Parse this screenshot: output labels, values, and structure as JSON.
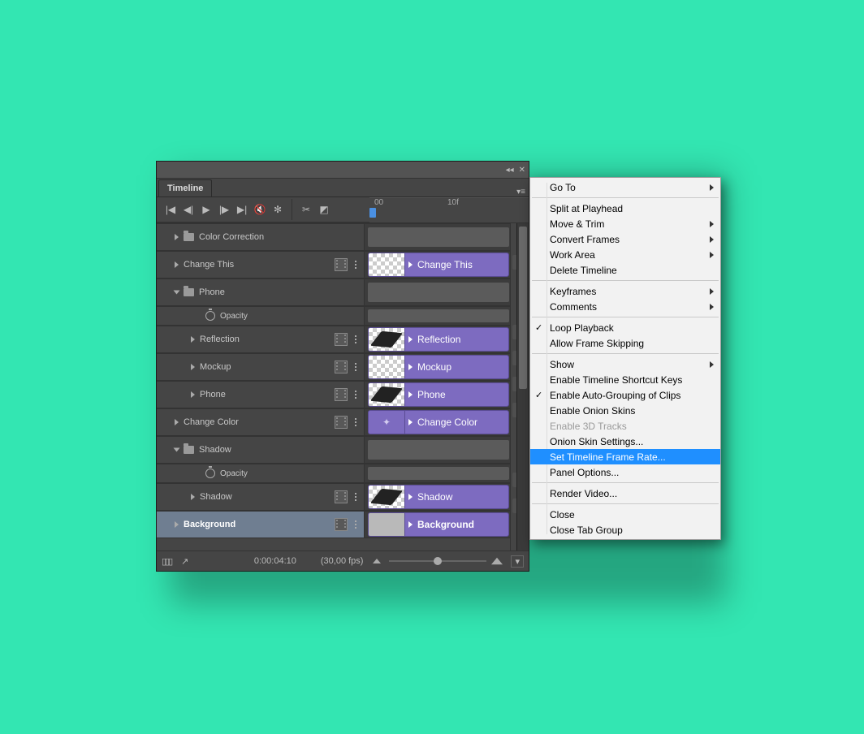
{
  "panel": {
    "title": "Timeline"
  },
  "ruler": {
    "t0": "00",
    "t1": "10f"
  },
  "layers": [
    {
      "id": "cc",
      "label": "Color Correction",
      "indent": 1,
      "folder": true,
      "open": false,
      "film": false,
      "kind": "folder"
    },
    {
      "id": "ct",
      "label": "Change This",
      "indent": 1,
      "open": false,
      "film": true,
      "kind": "layer",
      "clip": "Change This",
      "plus": true,
      "thumb": "checker"
    },
    {
      "id": "ph",
      "label": "Phone",
      "indent": 1,
      "folder": true,
      "open": true,
      "film": false,
      "kind": "folder",
      "bar": true
    },
    {
      "id": "ph_op",
      "label": "Opacity",
      "indent": 3,
      "stopwatch": true,
      "kind": "prop",
      "sub": true
    },
    {
      "id": "refl",
      "label": "Reflection",
      "indent": 2,
      "open": false,
      "film": true,
      "kind": "layer",
      "clip": "Reflection",
      "plus": true,
      "thumb": "device"
    },
    {
      "id": "mock",
      "label": "Mockup",
      "indent": 2,
      "open": false,
      "film": true,
      "kind": "layer",
      "clip": "Mockup",
      "plus": true,
      "thumb": "checker"
    },
    {
      "id": "phone2",
      "label": "Phone",
      "indent": 2,
      "open": false,
      "film": true,
      "kind": "layer",
      "clip": "Phone",
      "plus": true,
      "thumb": "device"
    },
    {
      "id": "cc2",
      "label": "Change Color",
      "indent": 1,
      "open": false,
      "film": true,
      "kind": "layer",
      "clip": "Change Color",
      "plus": true,
      "thumb": "icon"
    },
    {
      "id": "shg",
      "label": "Shadow",
      "indent": 1,
      "folder": true,
      "open": true,
      "film": false,
      "kind": "folder",
      "bar": true
    },
    {
      "id": "sh_op",
      "label": "Opacity",
      "indent": 3,
      "stopwatch": true,
      "kind": "prop",
      "sub": true
    },
    {
      "id": "sh",
      "label": "Shadow",
      "indent": 2,
      "open": false,
      "film": true,
      "kind": "layer",
      "clip": "Shadow",
      "plus": true,
      "thumb": "device"
    },
    {
      "id": "bg",
      "label": "Background",
      "indent": 1,
      "open": false,
      "film": true,
      "kind": "layer",
      "selected": true,
      "clip": "Background",
      "plus": true,
      "thumb": "gray",
      "bold": true
    }
  ],
  "footer": {
    "time": "0:00:04:10",
    "fps": "(30,00 fps)"
  },
  "menu": [
    {
      "label": "Go To",
      "sub": true
    },
    {
      "sep": true
    },
    {
      "label": "Split at Playhead"
    },
    {
      "label": "Move & Trim",
      "sub": true
    },
    {
      "label": "Convert Frames",
      "sub": true
    },
    {
      "label": "Work Area",
      "sub": true
    },
    {
      "label": "Delete Timeline"
    },
    {
      "sep": true
    },
    {
      "label": "Keyframes",
      "sub": true
    },
    {
      "label": "Comments",
      "sub": true
    },
    {
      "sep": true
    },
    {
      "label": "Loop Playback",
      "check": true
    },
    {
      "label": "Allow Frame Skipping"
    },
    {
      "sep": true
    },
    {
      "label": "Show",
      "sub": true
    },
    {
      "label": "Enable Timeline Shortcut Keys"
    },
    {
      "label": "Enable Auto-Grouping of Clips",
      "check": true
    },
    {
      "label": "Enable Onion Skins"
    },
    {
      "label": "Enable 3D Tracks",
      "dis": true
    },
    {
      "label": "Onion Skin Settings..."
    },
    {
      "label": "Set Timeline Frame Rate...",
      "hl": true
    },
    {
      "label": "Panel Options..."
    },
    {
      "sep": true
    },
    {
      "label": "Render Video..."
    },
    {
      "sep": true
    },
    {
      "label": "Close"
    },
    {
      "label": "Close Tab Group"
    }
  ]
}
